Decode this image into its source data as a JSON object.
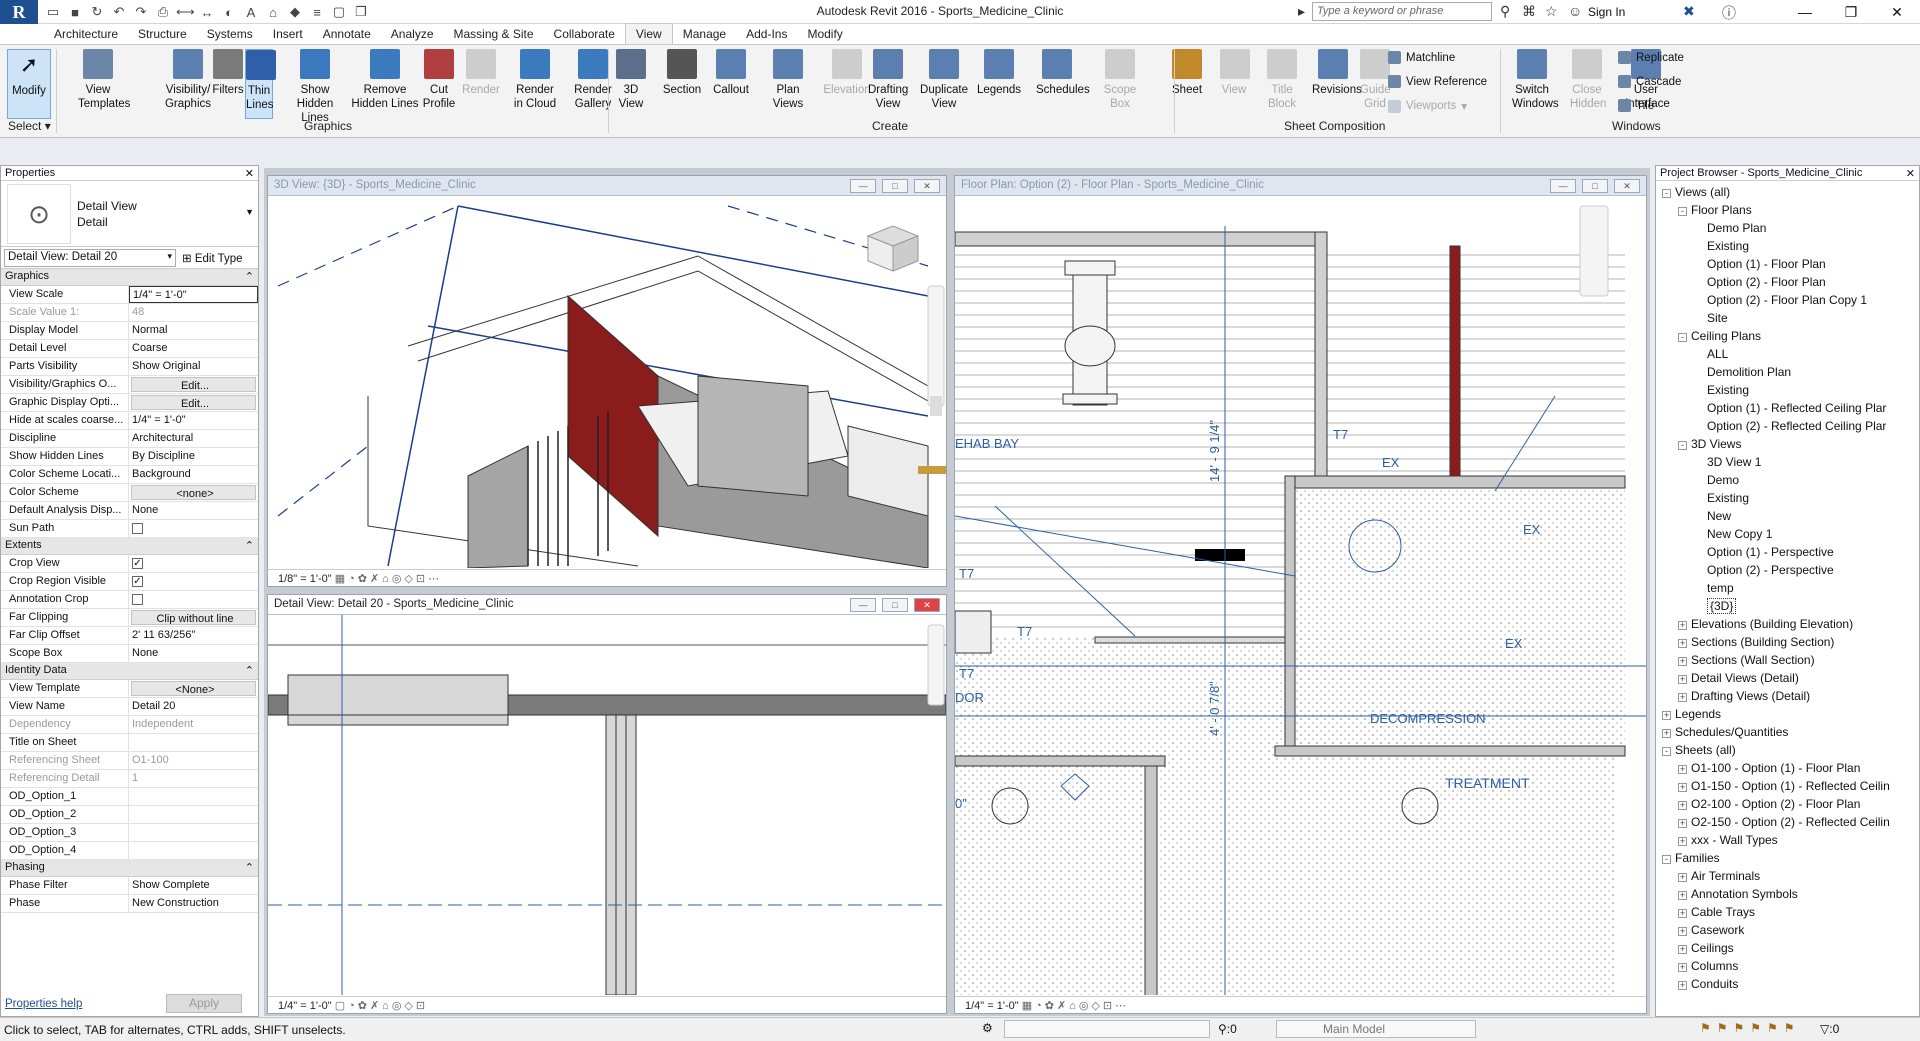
{
  "app": {
    "logo": "R",
    "title": "Autodesk Revit 2016 -",
    "project": "Sports_Medicine_Clinic",
    "search_placeholder": "Type a keyword or phrase",
    "sign_in": "Sign In",
    "qat_icons": [
      "open-icon",
      "save-icon",
      "sync-icon",
      "undo-icon",
      "redo-icon",
      "print-icon",
      "measure-icon",
      "dimension-icon",
      "tag-icon",
      "text-icon",
      "3d-view-icon",
      "section-icon",
      "thin-lines-icon",
      "close-hidden-icon",
      "switch-windows-icon"
    ]
  },
  "tabs": [
    "Architecture",
    "Structure",
    "Systems",
    "Insert",
    "Annotate",
    "Analyze",
    "Massing & Site",
    "Collaborate",
    "View",
    "Manage",
    "Add-Ins",
    "Modify"
  ],
  "active_tab": "View",
  "ribbon": {
    "modify": {
      "label": "Modify"
    },
    "select": "Select",
    "graphics_panel": "Graphics",
    "create_panel": "Create",
    "sheet_panel": "Sheet Composition",
    "windows_panel": "Windows",
    "buttons": [
      {
        "id": "view-templates",
        "line1": "View",
        "line2": "Templates",
        "enabled": true
      },
      {
        "id": "visibility-graphics",
        "line1": "Visibility/",
        "line2": "Graphics",
        "enabled": true
      },
      {
        "id": "filters",
        "line1": "Filters",
        "line2": "",
        "enabled": true
      },
      {
        "id": "thin-lines",
        "line1": "Thin",
        "line2": "Lines",
        "enabled": true
      },
      {
        "id": "show-hidden-lines",
        "line1": "Show",
        "line2": "Hidden Lines",
        "enabled": true
      },
      {
        "id": "remove-hidden-lines",
        "line1": "Remove",
        "line2": "Hidden Lines",
        "enabled": true
      },
      {
        "id": "cut-profile",
        "line1": "Cut",
        "line2": "Profile",
        "enabled": true
      },
      {
        "id": "render",
        "line1": "Render",
        "line2": "",
        "enabled": false
      },
      {
        "id": "render-in-cloud",
        "line1": "Render",
        "line2": "in Cloud",
        "enabled": true
      },
      {
        "id": "render-gallery",
        "line1": "Render",
        "line2": "Gallery",
        "enabled": true
      },
      {
        "id": "3d-view",
        "line1": "3D",
        "line2": "View",
        "enabled": true
      },
      {
        "id": "section",
        "line1": "Section",
        "line2": "",
        "enabled": true
      },
      {
        "id": "callout",
        "line1": "Callout",
        "line2": "",
        "enabled": true
      },
      {
        "id": "plan-views",
        "line1": "Plan",
        "line2": "Views",
        "enabled": true
      },
      {
        "id": "elevation",
        "line1": "Elevation",
        "line2": "",
        "enabled": false
      },
      {
        "id": "drafting-view",
        "line1": "Drafting",
        "line2": "View",
        "enabled": true
      },
      {
        "id": "duplicate-view",
        "line1": "Duplicate",
        "line2": "View",
        "enabled": true
      },
      {
        "id": "legends",
        "line1": "Legends",
        "line2": "",
        "enabled": true
      },
      {
        "id": "schedules",
        "line1": "Schedules",
        "line2": "",
        "enabled": true
      },
      {
        "id": "scope-box",
        "line1": "Scope",
        "line2": "Box",
        "enabled": false
      },
      {
        "id": "sheet",
        "line1": "Sheet",
        "line2": "",
        "enabled": true
      },
      {
        "id": "view",
        "line1": "View",
        "line2": "",
        "enabled": false
      },
      {
        "id": "title-block",
        "line1": "Title",
        "line2": "Block",
        "enabled": false
      },
      {
        "id": "revisions",
        "line1": "Revisions",
        "line2": "",
        "enabled": true
      },
      {
        "id": "guide-grid",
        "line1": "Guide",
        "line2": "Grid",
        "enabled": false
      },
      {
        "id": "switch-windows",
        "line1": "Switch",
        "line2": "Windows",
        "enabled": true
      },
      {
        "id": "close-hidden",
        "line1": "Close",
        "line2": "Hidden",
        "enabled": false
      },
      {
        "id": "user-interface",
        "line1": "User",
        "line2": "Interface",
        "enabled": true
      }
    ],
    "small": {
      "matchline": "Matchline",
      "view_reference": "View  Reference",
      "viewports": "Viewports",
      "replicate": "Replicate",
      "cascade": "Cascade",
      "tile": "Tile"
    }
  },
  "properties": {
    "title": "Properties",
    "type_line1": "Detail View",
    "type_line2": "Detail",
    "selector": "Detail View: Detail 20",
    "edit_type": "Edit Type",
    "sections": [
      {
        "name": "Graphics",
        "rows": [
          {
            "k": "View Scale",
            "v": "1/4\" = 1'-0\""
          },
          {
            "k": "Scale Value    1:",
            "v": "48",
            "grey": true
          },
          {
            "k": "Display Model",
            "v": "Normal"
          },
          {
            "k": "Detail Level",
            "v": "Coarse"
          },
          {
            "k": "Parts Visibility",
            "v": "Show Original"
          },
          {
            "k": "Visibility/Graphics O...",
            "v": "Edit...",
            "btn": true
          },
          {
            "k": "Graphic Display Opti...",
            "v": "Edit...",
            "btn": true
          },
          {
            "k": "Hide at scales coarse...",
            "v": "1/4\" = 1'-0\""
          },
          {
            "k": "Discipline",
            "v": "Architectural"
          },
          {
            "k": "Show Hidden Lines",
            "v": "By Discipline"
          },
          {
            "k": "Color Scheme Locati...",
            "v": "Background"
          },
          {
            "k": "Color Scheme",
            "v": "<none>",
            "btn": true
          },
          {
            "k": "Default Analysis Disp...",
            "v": "None"
          },
          {
            "k": "Sun Path",
            "v": "",
            "cb": false
          }
        ]
      },
      {
        "name": "Extents",
        "rows": [
          {
            "k": "Crop View",
            "v": "",
            "cb": true
          },
          {
            "k": "Crop Region Visible",
            "v": "",
            "cb": true
          },
          {
            "k": "Annotation Crop",
            "v": "",
            "cb": false
          },
          {
            "k": "Far Clipping",
            "v": "Clip without line",
            "btn": true
          },
          {
            "k": "Far Clip Offset",
            "v": "2'  11 63/256\""
          },
          {
            "k": "Scope Box",
            "v": "None"
          }
        ]
      },
      {
        "name": "Identity Data",
        "rows": [
          {
            "k": "View Template",
            "v": "<None>",
            "btn": true
          },
          {
            "k": "View Name",
            "v": "Detail 20"
          },
          {
            "k": "Dependency",
            "v": "Independent",
            "grey": true
          },
          {
            "k": "Title on Sheet",
            "v": ""
          },
          {
            "k": "Referencing Sheet",
            "v": "O1-100",
            "grey": true
          },
          {
            "k": "Referencing Detail",
            "v": "1",
            "grey": true
          },
          {
            "k": "OD_Option_1",
            "v": ""
          },
          {
            "k": "OD_Option_2",
            "v": ""
          },
          {
            "k": "OD_Option_3",
            "v": ""
          },
          {
            "k": "OD_Option_4",
            "v": ""
          }
        ]
      },
      {
        "name": "Phasing",
        "rows": [
          {
            "k": "Phase Filter",
            "v": "Show Complete"
          },
          {
            "k": "Phase",
            "v": "New Construction"
          }
        ]
      }
    ],
    "help": "Properties help",
    "apply": "Apply"
  },
  "views": {
    "v3d": {
      "title": "3D View: {3D} - Sports_Medicine_Clinic",
      "scale": "1/8\" = 1'-0\""
    },
    "detail": {
      "title": "Detail View: Detail 20 - Sports_Medicine_Clinic",
      "scale": "1/4\" = 1'-0\""
    },
    "plan": {
      "title": "Floor Plan: Option (2) - Floor Plan - Sports_Medicine_Clinic",
      "scale": "1/4\" = 1'-0\"",
      "labels": {
        "rehab": "EHAB BAY",
        "decompression": "DECOMPRESSION",
        "treatment": "TREATMENT",
        "dor": "DOR",
        "dim1": "14' - 9 1/4\"",
        "dim2": "4' - 0 7/8\"",
        "dim3": "0\"",
        "t7": "T7",
        "ex": "EX"
      }
    }
  },
  "browser": {
    "title": "Project Browser - Sports_Medicine_Clinic",
    "nodes": [
      {
        "t": "Views (all)",
        "d": 0,
        "tg": "-"
      },
      {
        "t": "Floor Plans",
        "d": 1,
        "tg": "-"
      },
      {
        "t": "Demo Plan",
        "d": 2
      },
      {
        "t": "Existing",
        "d": 2
      },
      {
        "t": "Option (1) - Floor Plan",
        "d": 2
      },
      {
        "t": "Option (2) - Floor Plan",
        "d": 2
      },
      {
        "t": "Option (2) - Floor Plan Copy 1",
        "d": 2
      },
      {
        "t": "Site",
        "d": 2
      },
      {
        "t": "Ceiling Plans",
        "d": 1,
        "tg": "-"
      },
      {
        "t": "ALL",
        "d": 2
      },
      {
        "t": "Demolition Plan",
        "d": 2
      },
      {
        "t": "Existing",
        "d": 2
      },
      {
        "t": "Option (1) - Reflected Ceiling Plar",
        "d": 2
      },
      {
        "t": "Option (2) - Reflected Ceiling Plar",
        "d": 2
      },
      {
        "t": "3D Views",
        "d": 1,
        "tg": "-"
      },
      {
        "t": "3D View 1",
        "d": 2
      },
      {
        "t": "Demo",
        "d": 2
      },
      {
        "t": "Existing",
        "d": 2
      },
      {
        "t": "New",
        "d": 2
      },
      {
        "t": "New Copy 1",
        "d": 2
      },
      {
        "t": "Option (1) - Perspective",
        "d": 2
      },
      {
        "t": "Option (2) - Perspective",
        "d": 2
      },
      {
        "t": "temp",
        "d": 2
      },
      {
        "t": "{3D}",
        "d": 2,
        "sel": true
      },
      {
        "t": "Elevations (Building Elevation)",
        "d": 1,
        "tg": "+"
      },
      {
        "t": "Sections (Building Section)",
        "d": 1,
        "tg": "+"
      },
      {
        "t": "Sections (Wall Section)",
        "d": 1,
        "tg": "+"
      },
      {
        "t": "Detail Views (Detail)",
        "d": 1,
        "tg": "+"
      },
      {
        "t": "Drafting Views (Detail)",
        "d": 1,
        "tg": "+"
      },
      {
        "t": "Legends",
        "d": 0,
        "tg": "+"
      },
      {
        "t": "Schedules/Quantities",
        "d": 0,
        "tg": "+"
      },
      {
        "t": "Sheets (all)",
        "d": 0,
        "tg": "-"
      },
      {
        "t": "O1-100 - Option (1) - Floor Plan",
        "d": 1,
        "tg": "+"
      },
      {
        "t": "O1-150 - Option (1) - Reflected Ceilin",
        "d": 1,
        "tg": "+"
      },
      {
        "t": "O2-100 - Option (2) - Floor Plan",
        "d": 1,
        "tg": "+"
      },
      {
        "t": "O2-150 - Option (2) - Reflected Ceilin",
        "d": 1,
        "tg": "+"
      },
      {
        "t": "xxx - Wall Types",
        "d": 1,
        "tg": "+"
      },
      {
        "t": "Families",
        "d": 0,
        "tg": "-"
      },
      {
        "t": "Air Terminals",
        "d": 1,
        "tg": "+"
      },
      {
        "t": "Annotation Symbols",
        "d": 1,
        "tg": "+"
      },
      {
        "t": "Cable Trays",
        "d": 1,
        "tg": "+"
      },
      {
        "t": "Casework",
        "d": 1,
        "tg": "+"
      },
      {
        "t": "Ceilings",
        "d": 1,
        "tg": "+"
      },
      {
        "t": "Columns",
        "d": 1,
        "tg": "+"
      },
      {
        "t": "Conduits",
        "d": 1,
        "tg": "+"
      }
    ]
  },
  "status": {
    "hint": "Click to select, TAB for alternates, CTRL adds, SHIFT unselects.",
    "count": ":0",
    "model": "Main Model",
    "filter_count": ":0"
  },
  "colors": {
    "accent": "#1d4f91",
    "wall_red": "#8b1c1c",
    "plan_line": "#2b5ea7"
  }
}
